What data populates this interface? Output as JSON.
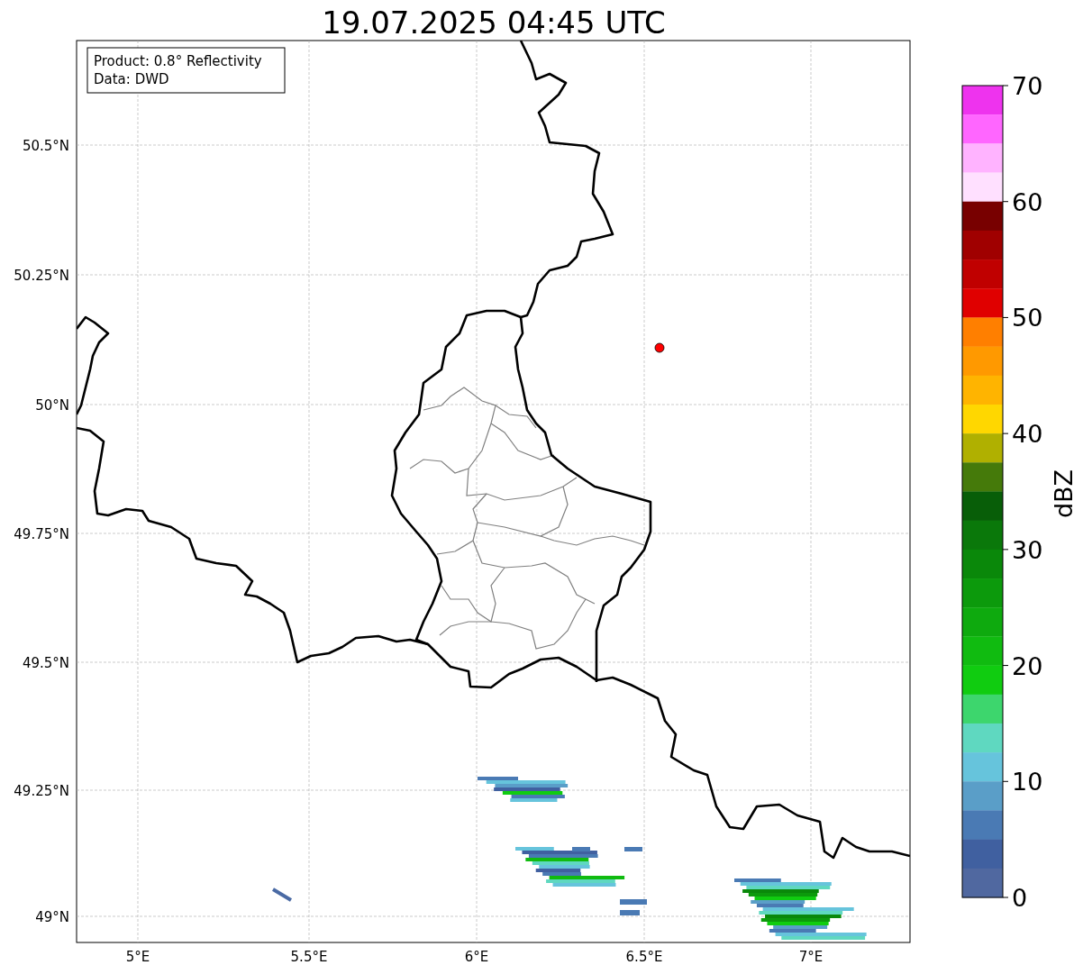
{
  "title": "19.07.2025 04:45 UTC",
  "legend": [
    "Product: 0.8° Reflectivity",
    "Data: DWD"
  ],
  "lat_ticks": [
    "50.5°N",
    "50.25°N",
    "50°N",
    "49.75°N",
    "49.5°N",
    "49.25°N",
    "49°N"
  ],
  "lon_ticks": [
    "5°E",
    "5.5°E",
    "6°E",
    "6.5°E",
    "7°E"
  ],
  "colorbar": {
    "label": "dBZ",
    "ticks": [
      "70",
      "60",
      "50",
      "40",
      "30",
      "20",
      "10",
      "0"
    ],
    "segments": [
      {
        "color": "#ee33ee"
      },
      {
        "color": "#ff66ff"
      },
      {
        "color": "#ffb3ff"
      },
      {
        "color": "#ffe0ff"
      },
      {
        "color": "#780000"
      },
      {
        "color": "#a00000"
      },
      {
        "color": "#c00000"
      },
      {
        "color": "#e00000"
      },
      {
        "color": "#ff7f00"
      },
      {
        "color": "#ff9900"
      },
      {
        "color": "#ffb400"
      },
      {
        "color": "#ffd700"
      },
      {
        "color": "#b0b000"
      },
      {
        "color": "#457a0a"
      },
      {
        "color": "#085e08"
      },
      {
        "color": "#0a780a"
      },
      {
        "color": "#0a880a"
      },
      {
        "color": "#0c9a0c"
      },
      {
        "color": "#0eaa0e"
      },
      {
        "color": "#10bb10"
      },
      {
        "color": "#10cc10"
      },
      {
        "color": "#3dd66d"
      },
      {
        "color": "#5fd8c0"
      },
      {
        "color": "#66c4dc"
      },
      {
        "color": "#5a9ec8"
      },
      {
        "color": "#4a7ab4"
      },
      {
        "color": "#4060a0"
      },
      {
        "color": "#5068a0"
      }
    ]
  }
}
